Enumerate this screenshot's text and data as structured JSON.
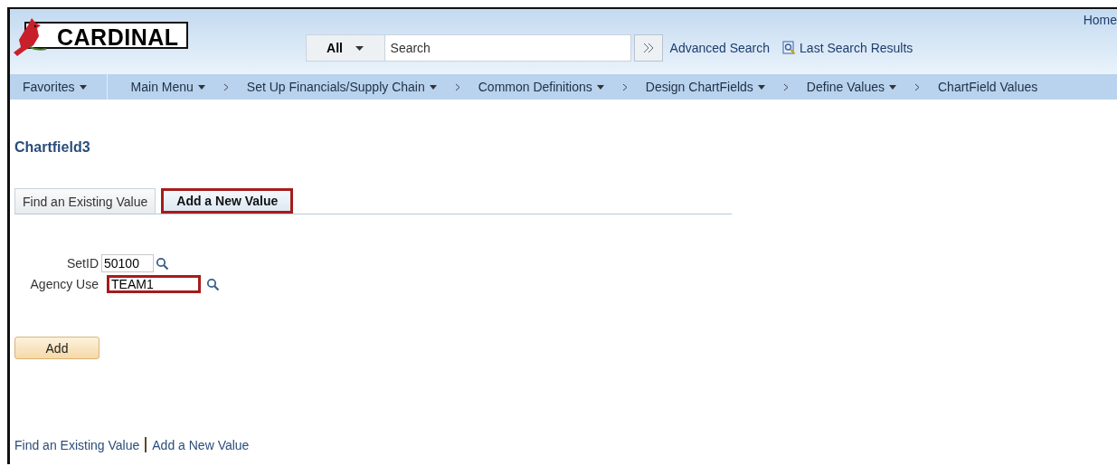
{
  "header": {
    "logo": "CARDINAL",
    "home_link": "Home",
    "search": {
      "scope": "All",
      "placeholder": "Search"
    },
    "links": [
      {
        "label": "Advanced Search",
        "kind": "text"
      },
      {
        "label": "Last Search Results",
        "kind": "icon"
      }
    ]
  },
  "nav": [
    {
      "label": "Favorites",
      "separator": false
    },
    {
      "label": "Main Menu",
      "separator": false
    },
    {
      "label": "Set Up Financials/Supply Chain",
      "separator": true
    },
    {
      "label": "Common Definitions",
      "separator": true
    },
    {
      "label": "Design ChartFields",
      "separator": true
    },
    {
      "label": "Define Values",
      "separator": true
    },
    {
      "label": "ChartField Values",
      "separator": true
    }
  ],
  "page_title": "Chartfield3",
  "tabs": [
    {
      "label": "Find an Existing Value",
      "selected": false,
      "highlighted": false
    },
    {
      "label": "Add a New Value",
      "selected": true,
      "highlighted": true
    }
  ],
  "fields": [
    {
      "label": "SetID",
      "value": "50100",
      "highlighted": false
    },
    {
      "label": "Agency Use",
      "value": "TEAM1",
      "highlighted": true
    }
  ],
  "add_button": "Add",
  "footer_links": [
    "Find an Existing Value",
    "Add a New Value"
  ]
}
